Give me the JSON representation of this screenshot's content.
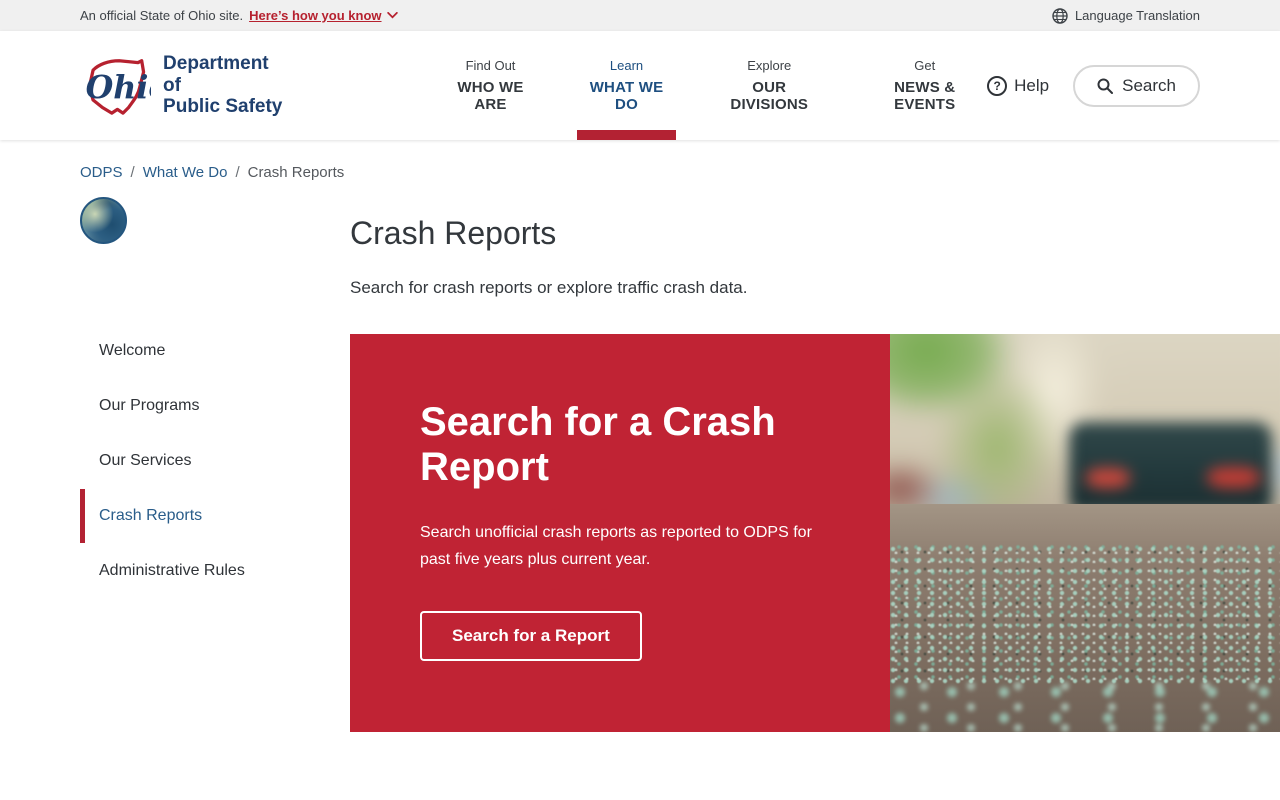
{
  "topbar": {
    "official_text": "An official State of Ohio site.",
    "how_link": "Here’s how you know",
    "language": "Language Translation"
  },
  "header": {
    "logo_script": "Ohio",
    "logo_line1": "Department of",
    "logo_line2": "Public Safety",
    "nav": [
      {
        "eyebrow": "Find Out",
        "label": "WHO WE ARE"
      },
      {
        "eyebrow": "Learn",
        "label": "WHAT WE DO"
      },
      {
        "eyebrow": "Explore",
        "label": "OUR DIVISIONS"
      },
      {
        "eyebrow": "Get",
        "label": "NEWS & EVENTS"
      }
    ],
    "help_label": "Help",
    "search_label": "Search"
  },
  "breadcrumb": {
    "items": [
      "ODPS",
      "What We Do",
      "Crash Reports"
    ],
    "separator": "/"
  },
  "sidebar": {
    "items": [
      {
        "label": "Welcome"
      },
      {
        "label": "Our Programs"
      },
      {
        "label": "Our Services"
      },
      {
        "label": "Crash Reports"
      },
      {
        "label": "Administrative Rules"
      }
    ]
  },
  "main": {
    "title": "Crash Reports",
    "subtitle": "Search for crash reports or explore traffic crash data.",
    "card": {
      "heading": "Search for a Crash Report",
      "body": "Search unofficial crash reports as reported to ODPS for past five years plus current year.",
      "button": "Search for a Report"
    }
  },
  "colors": {
    "accent_red": "#c02334",
    "link_blue": "#2a5d8a",
    "logo_navy": "#20406e",
    "topbar_bg": "#f0f0f0"
  },
  "icons": {
    "chevron_down": "chevron-down-icon",
    "globe": "globe-icon",
    "help": "question-circle-icon",
    "search": "magnifier-icon"
  }
}
